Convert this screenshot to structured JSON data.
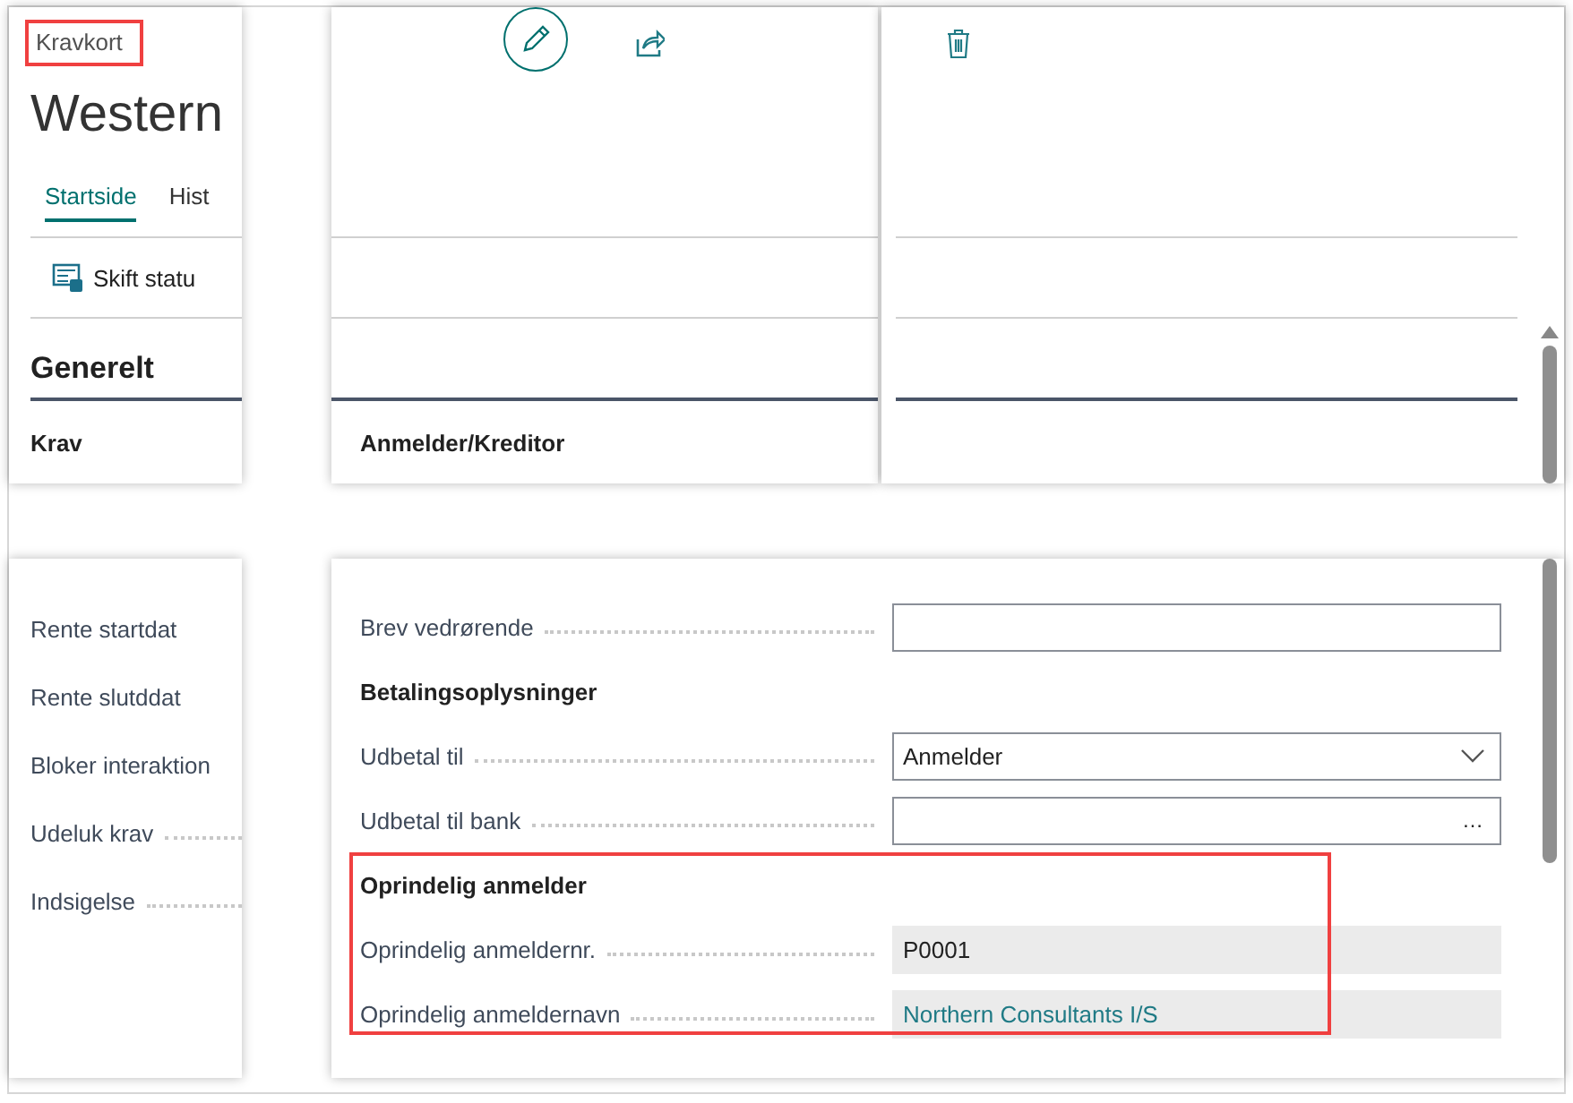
{
  "breadcrumb": {
    "text": "Kravkort",
    "highlighted": true
  },
  "title": "Western",
  "tabs": [
    {
      "label": "Startside",
      "selected": true
    },
    {
      "label": "Hist",
      "selected": false
    }
  ],
  "action_bar": [
    {
      "label": "Skift statu"
    }
  ],
  "section": {
    "title": "Generelt"
  },
  "left_column": {
    "heading": "Krav",
    "fields": [
      {
        "label": "Rente startdat",
        "leader": false
      },
      {
        "label": "Rente slutddat",
        "leader": false
      },
      {
        "label": "Bloker interaktion",
        "leader": false
      },
      {
        "label": "Udeluk krav",
        "leader": true
      },
      {
        "label": "Indsigelse",
        "leader": true
      }
    ]
  },
  "right_column": {
    "heading": "Anmelder/Kreditor",
    "fields": [
      {
        "kind": "input",
        "label": "Brev vedrørende"
      }
    ],
    "groups": [
      {
        "title": "Betalingsoplysninger",
        "highlighted": false,
        "fields": [
          {
            "kind": "dropdown",
            "label": "Udbetal til",
            "value": "Anmelder"
          },
          {
            "kind": "lookup",
            "label": "Udbetal til bank",
            "button": "…"
          }
        ]
      },
      {
        "title": "Oprindelig anmelder",
        "highlighted": true,
        "fields": [
          {
            "kind": "readonly",
            "label": "Oprindelig anmeldernr.",
            "value": "P0001",
            "link": false
          },
          {
            "kind": "readonly",
            "label": "Oprindelig anmeldernavn",
            "value": "Northern Consultants I/S",
            "link": true
          }
        ]
      }
    ]
  }
}
